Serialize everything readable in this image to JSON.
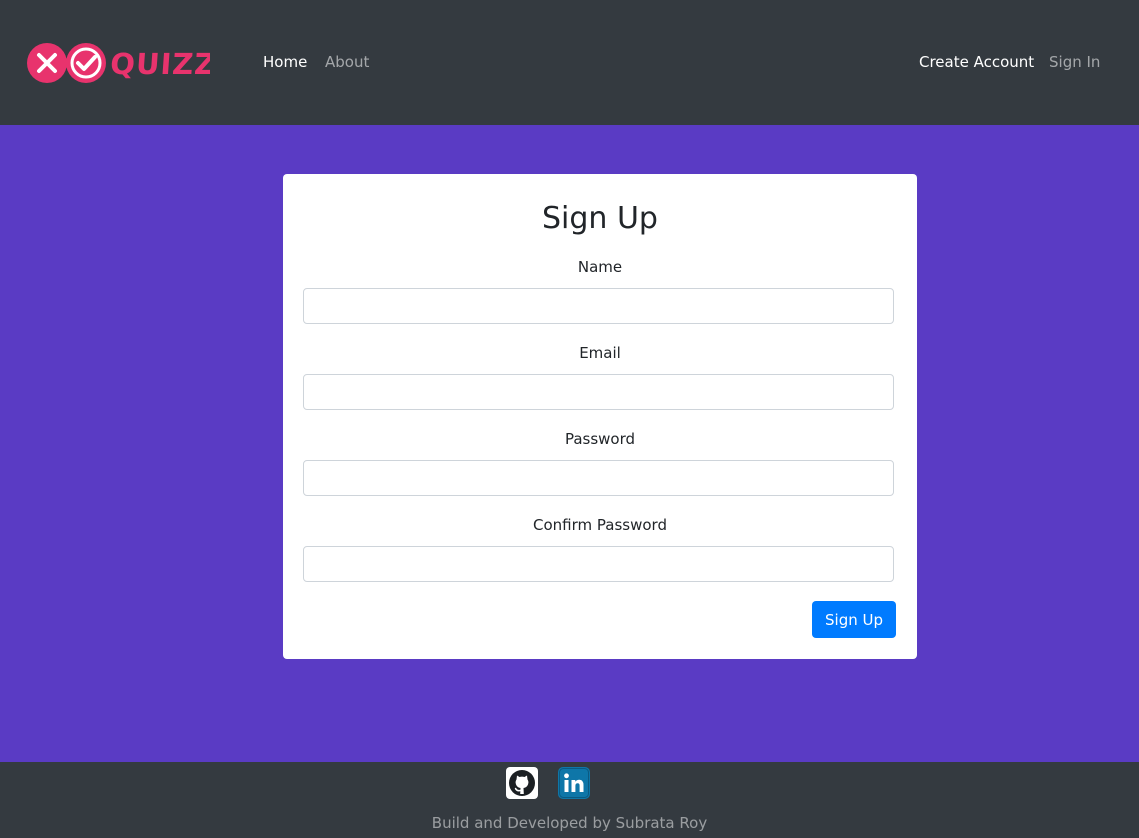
{
  "brand": {
    "name": "QUIZZY",
    "accent_color": "#e8336d",
    "icons": [
      "close-icon",
      "check-icon"
    ]
  },
  "nav": {
    "home": "Home",
    "about": "About",
    "create_account": "Create Account",
    "sign_in": "Sign In"
  },
  "form": {
    "title": "Sign Up",
    "name_label": "Name",
    "name_value": "",
    "email_label": "Email",
    "email_value": "",
    "password_label": "Password",
    "password_value": "",
    "confirm_label": "Confirm Password",
    "confirm_value": "",
    "submit_label": "Sign Up"
  },
  "footer": {
    "icons": [
      "github-icon",
      "linkedin-icon"
    ],
    "credit": "Build and Developed by Subrata Roy"
  },
  "colors": {
    "page_background": "#5a3bc4",
    "navbar_background": "#343a40",
    "primary_button": "#007bff"
  }
}
